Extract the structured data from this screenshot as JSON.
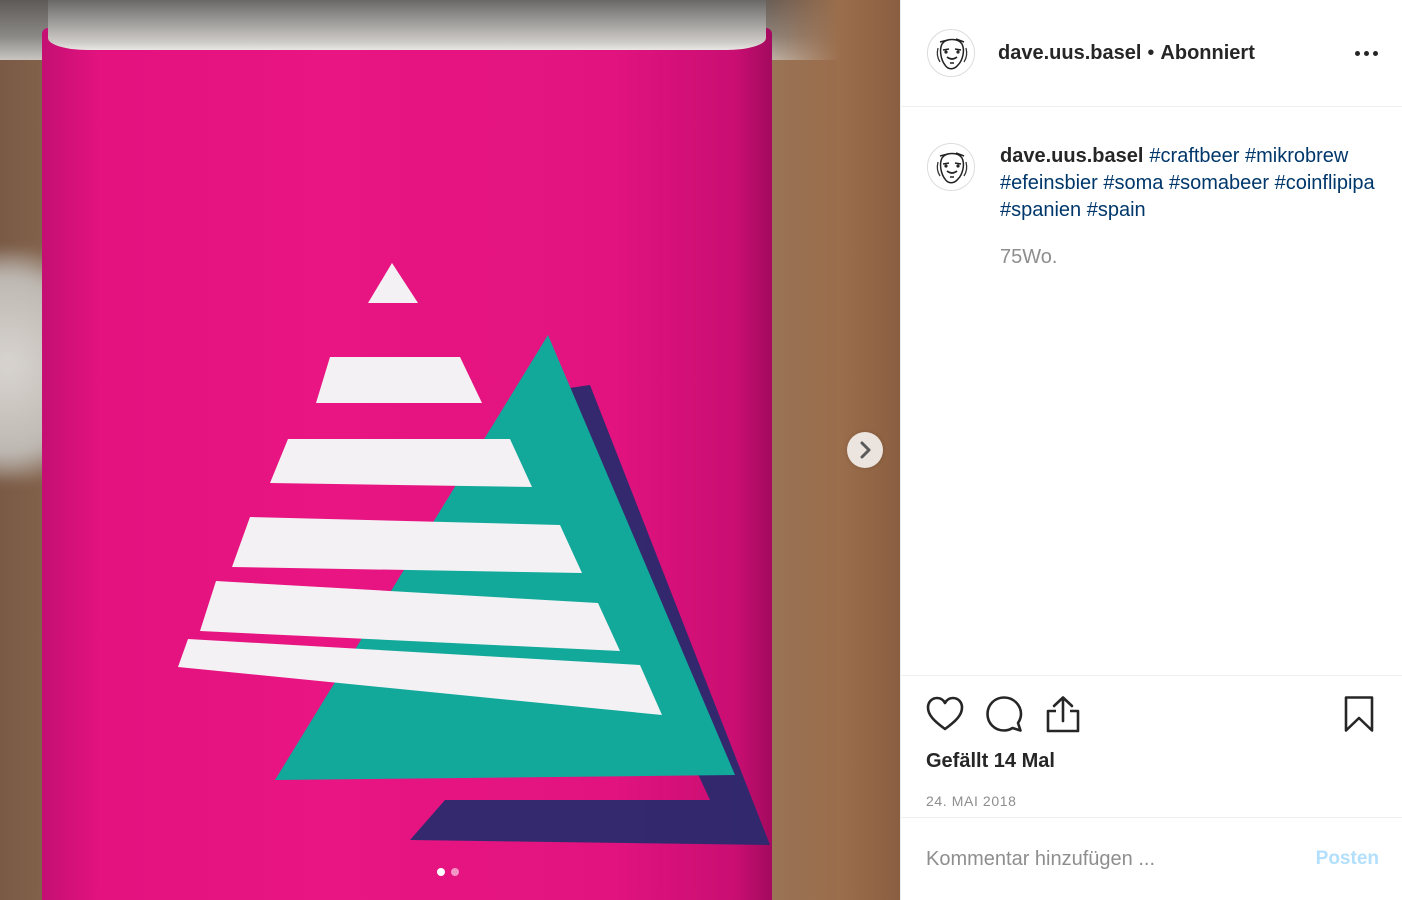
{
  "post": {
    "username": "dave.uus.basel",
    "separator": "•",
    "follow_status": "Abonniert",
    "caption_user": "dave.uus.basel",
    "caption_tags": "#craftbeer #mikrobrew #efeinsbier #soma #somabeer #coinflipipa #spanien #spain",
    "time_ago": "75Wo.",
    "likes_text": "Gefällt 14 Mal",
    "date_text": "24. MAI 2018"
  },
  "comment_box": {
    "placeholder": "Kommentar hinzufügen ...",
    "post_label": "Posten"
  },
  "carousel": {
    "total_slides": 2,
    "active_slide": 1
  },
  "icons": {
    "like": "heart-icon",
    "comment": "comment-bubble-icon",
    "share": "share-upload-icon",
    "save": "bookmark-icon",
    "more": "more-options-icon",
    "next": "chevron-right-icon"
  },
  "colors": {
    "can_pink": "#e81582",
    "logo_teal": "#12a99b",
    "logo_navy": "#2a2a6e",
    "hashtag_blue": "#00376b",
    "post_button_disabled": "#b2dffc"
  }
}
